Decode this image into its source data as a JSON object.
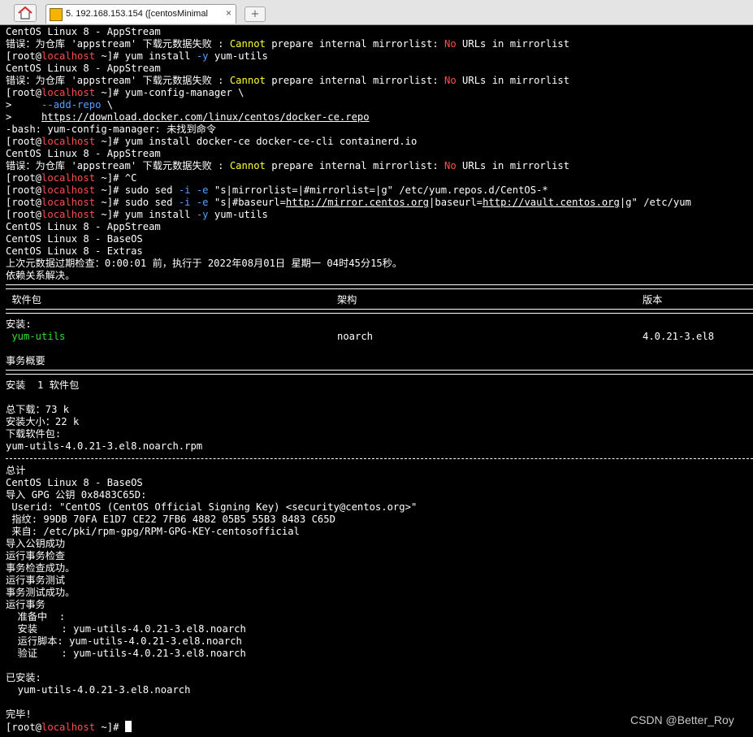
{
  "window": {
    "tab_title": "5. 192.168.153.154 ([centosMinimal",
    "home_icon": "home-icon",
    "tab_icon": "terminal-icon",
    "close_glyph": "×",
    "new_tab_glyph": "+"
  },
  "terminal": {
    "prompt_root": "[root@",
    "prompt_host": "localhost",
    "prompt_tail": " ~]# ",
    "l0": "CentOS Linux 8 - AppStream",
    "err_a": "错误：为仓库 'appstream' 下载元数据失败 : ",
    "err_cannot": "Cannot",
    "err_b": " prepare internal mirrorlist: ",
    "err_no": "No",
    "err_c": " URLs in mirrorlist",
    "cmd_yum_pre": "yum install ",
    "flag_y": "-y",
    "cmd_yum_post": " yum-utils",
    "cmd_config": "yum-config-manager \\",
    "cont1_pre": ">     ",
    "cont1_flag": "--add-repo",
    "cont1_post": " \\",
    "cont2_pre": ">     ",
    "cont2_url": "https://download.docker.com/linux/centos/docker-ce.repo",
    "bash_err": "-bash: yum-config-manager: 未找到命令",
    "cmd_docker": "yum install docker-ce docker-ce-cli containerd.io",
    "cmd_ctrlc": "^C",
    "sed_pre": "sudo sed ",
    "sed_i": "-i",
    "sed_sp": " ",
    "sed_e": "-e",
    "sed1_post": " \"s|mirrorlist=|#mirrorlist=|g\" /etc/yum.repos.d/CentOS-*",
    "sed2_mid": " \"s|#baseurl=",
    "sed2_url1": "http://mirror.centos.org",
    "sed2_mid2": "|baseurl=",
    "sed2_url2": "http://vault.centos.org",
    "sed2_post": "|g\" /etc/yum",
    "repo_appstream": "CentOS Linux 8 - AppStream",
    "repo_baseos": "CentOS Linux 8 - BaseOS",
    "repo_extras": "CentOS Linux 8 - Extras",
    "meta_check": "上次元数据过期检查：0:00:01 前，执行于 2022年08月01日 星期一 04时45分15秒。",
    "deps_resolved": "依赖关系解决。",
    "col_package": " 软件包",
    "col_arch": "架构",
    "col_version": "版本",
    "installing": "安装:",
    "pkg_name": " yum-utils",
    "pkg_arch": "noarch",
    "pkg_version": "4.0.21-3.el8",
    "tx_summary": "事务概要",
    "install_count": "安装  1 软件包",
    "total_download": "总下载：73 k",
    "installed_size": "安装大小：22 k",
    "downloading": "下载软件包:",
    "rpm_file": "yum-utils-4.0.21-3.el8.noarch.rpm",
    "total": "总计",
    "gpg_import": "导入 GPG 公钥 0x8483C65D:",
    "gpg_userid": " Userid: \"CentOS (CentOS Official Signing Key) <security@centos.org>\"",
    "gpg_fpr": " 指纹: 99DB 70FA E1D7 CE22 7FB6 4882 05B5 55B3 8483 C65D",
    "gpg_from": " 来自: /etc/pki/rpm-gpg/RPM-GPG-KEY-centosofficial",
    "key_ok": "导入公钥成功",
    "tx_check": "运行事务检查",
    "tx_check_ok": "事务检查成功。",
    "tx_test": "运行事务测试",
    "tx_test_ok": "事务测试成功。",
    "tx_run": "运行事务",
    "step_prep": "  准备中  :",
    "step_install": "  安装    : yum-utils-4.0.21-3.el8.noarch",
    "step_script": "  运行脚本: yum-utils-4.0.21-3.el8.noarch",
    "step_verify": "  验证    : yum-utils-4.0.21-3.el8.noarch",
    "installed_hdr": "已安装:",
    "installed_pkg": "  yum-utils-4.0.21-3.el8.noarch",
    "done": "完毕!"
  },
  "colors": {
    "background": "#000000",
    "text": "#ffffff",
    "hostname": "#ff4d4d",
    "keyword_yellow": "#ffff33",
    "flag_blue": "#55a0ff",
    "package_green": "#33dd33"
  },
  "watermark": "CSDN @Better_Roy"
}
